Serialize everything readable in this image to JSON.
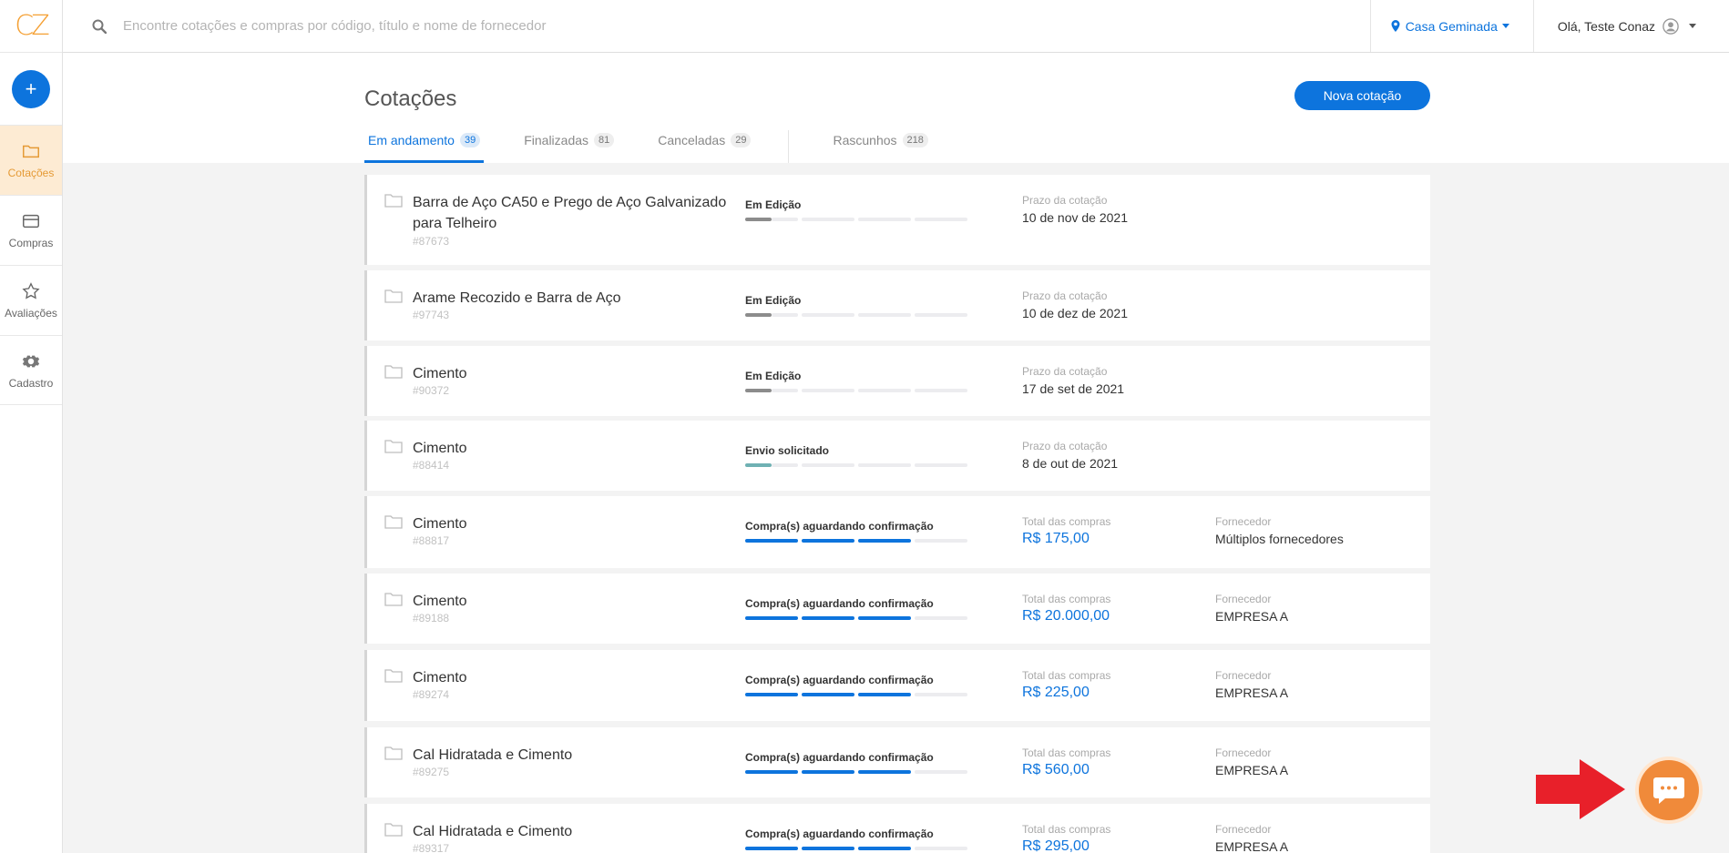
{
  "brand": {
    "logo": "CZ",
    "logo_color": "#f5a033",
    "accent": "#0d74dd"
  },
  "sidebar": {
    "new_label": "+",
    "items": [
      {
        "label": "Cotações",
        "icon": "folder-icon",
        "active": true
      },
      {
        "label": "Compras",
        "icon": "credit-card-icon",
        "active": false
      },
      {
        "label": "Avaliações",
        "icon": "star-icon",
        "active": false
      },
      {
        "label": "Cadastro",
        "icon": "gear-icon",
        "active": false
      }
    ]
  },
  "topbar": {
    "search_placeholder": "Encontre cotações e compras por código, título e nome de fornecedor",
    "location": "Casa Geminada",
    "user_greeting": "Olá, Teste Conaz"
  },
  "page": {
    "title": "Cotações",
    "new_button": "Nova cotação",
    "tabs": [
      {
        "label": "Em andamento",
        "count": "39",
        "active": true
      },
      {
        "label": "Finalizadas",
        "count": "81",
        "active": false
      },
      {
        "label": "Canceladas",
        "count": "29",
        "active": false
      },
      {
        "label": "Rascunhos",
        "count": "218",
        "active": false
      }
    ]
  },
  "quotes": [
    {
      "title": "Barra de Aço CA50 e Prego de Aço Galvanizado para Telheiro",
      "code": "#87673",
      "status": "Em Edição",
      "progress": 1,
      "progress_color": "#8c8c8c",
      "label1": "Prazo da cotação",
      "value1": "10 de nov de 2021"
    },
    {
      "title": "Arame Recozido e Barra de Aço",
      "code": "#97743",
      "status": "Em Edição",
      "progress": 1,
      "progress_color": "#8c8c8c",
      "label1": "Prazo da cotação",
      "value1": "10 de dez de 2021"
    },
    {
      "title": "Cimento",
      "code": "#90372",
      "status": "Em Edição",
      "progress": 1,
      "progress_color": "#8c8c8c",
      "label1": "Prazo da cotação",
      "value1": "17 de set de 2021"
    },
    {
      "title": "Cimento",
      "code": "#88414",
      "status": "Envio solicitado",
      "progress": 1,
      "progress_color": "#6fb1b3",
      "label1": "Prazo da cotação",
      "value1": "8 de out de 2021"
    },
    {
      "title": "Cimento",
      "code": "#88817",
      "status": "Compra(s) aguardando confirmação",
      "progress": 3,
      "progress_color": "#0d74dd",
      "label1": "Total das compras",
      "value1": "R$ 175,00",
      "label2": "Fornecedor",
      "value2": "Múltiplos fornecedores"
    },
    {
      "title": "Cimento",
      "code": "#89188",
      "status": "Compra(s) aguardando confirmação",
      "progress": 3,
      "progress_color": "#0d74dd",
      "label1": "Total das compras",
      "value1": "R$ 20.000,00",
      "label2": "Fornecedor",
      "value2": "EMPRESA A"
    },
    {
      "title": "Cimento",
      "code": "#89274",
      "status": "Compra(s) aguardando confirmação",
      "progress": 3,
      "progress_color": "#0d74dd",
      "label1": "Total das compras",
      "value1": "R$ 225,00",
      "label2": "Fornecedor",
      "value2": "EMPRESA A"
    },
    {
      "title": "Cal Hidratada e Cimento",
      "code": "#89275",
      "status": "Compra(s) aguardando confirmação",
      "progress": 3,
      "progress_color": "#0d74dd",
      "label1": "Total das compras",
      "value1": "R$ 560,00",
      "label2": "Fornecedor",
      "value2": "EMPRESA A"
    },
    {
      "title": "Cal Hidratada e Cimento",
      "code": "#89317",
      "status": "Compra(s) aguardando confirmação",
      "progress": 3,
      "progress_color": "#0d74dd",
      "label1": "Total das compras",
      "value1": "R$ 295,00",
      "label2": "Fornecedor",
      "value2": "EMPRESA A"
    }
  ],
  "chat": {
    "icon": "chat-icon",
    "color": "#f08a3a",
    "arrow_color": "#e8202a"
  }
}
